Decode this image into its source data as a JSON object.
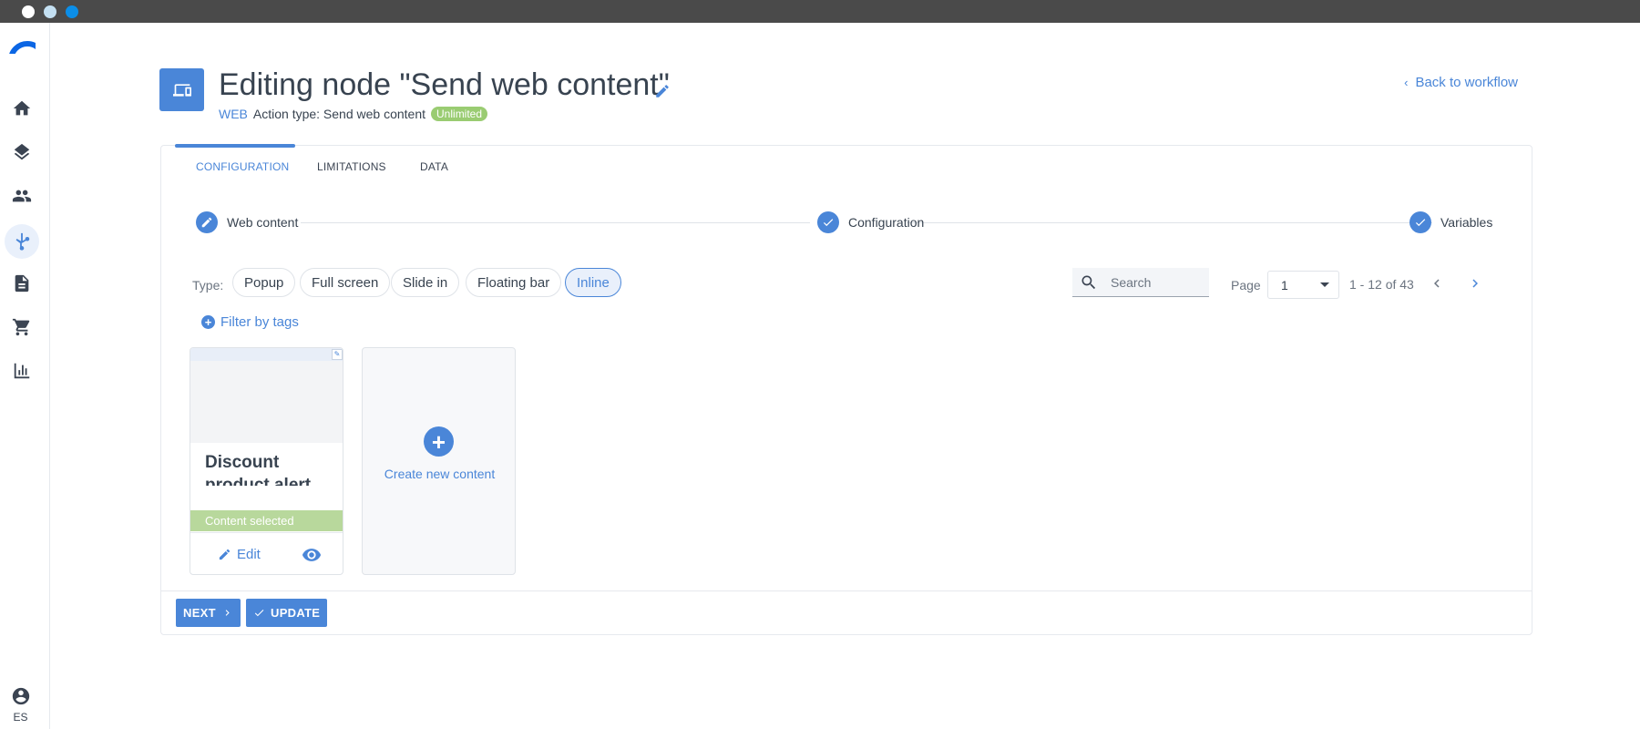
{
  "sidebar": {
    "logo": "brand-logo",
    "items": [
      {
        "name": "home",
        "icon": "home-icon"
      },
      {
        "name": "layers",
        "icon": "layers-icon"
      },
      {
        "name": "contacts",
        "icon": "people-icon"
      },
      {
        "name": "workflows",
        "icon": "workflow-icon",
        "active": true
      },
      {
        "name": "documents",
        "icon": "document-icon"
      },
      {
        "name": "ecommerce",
        "icon": "cart-icon"
      },
      {
        "name": "analytics",
        "icon": "bar-chart-icon"
      }
    ],
    "user_lang": "ES"
  },
  "header": {
    "title": "Editing node \"Send web content\"",
    "channel": "WEB",
    "action_type": "Action type: Send web content",
    "badge": "Unlimited",
    "back_link": "Back to workflow"
  },
  "tabs": [
    {
      "label": "CONFIGURATION",
      "active": true
    },
    {
      "label": "LIMITATIONS"
    },
    {
      "label": "DATA"
    }
  ],
  "stepper": [
    {
      "label": "Web content",
      "icon": "pencil-icon"
    },
    {
      "label": "Configuration",
      "icon": "check-icon"
    },
    {
      "label": "Variables",
      "icon": "check-icon"
    }
  ],
  "filters": {
    "type_label": "Type:",
    "types": [
      "Popup",
      "Full screen",
      "Slide in",
      "Floating bar",
      "Inline"
    ],
    "active_type": "Inline",
    "search_placeholder": "Search",
    "page_label": "Page",
    "page_value": "1",
    "range": "1 - 12 of 43",
    "filter_tags": "Filter by tags"
  },
  "content_tiles": [
    {
      "title": "Discount product alert",
      "status": "Content selected",
      "edit_label": "Edit"
    }
  ],
  "create_label": "Create new content",
  "footer": {
    "next_label": "NEXT",
    "update_label": "UPDATE"
  },
  "colors": {
    "accent": "#4a86d8",
    "success": "#9acc72",
    "selected": "#b8d89c"
  }
}
